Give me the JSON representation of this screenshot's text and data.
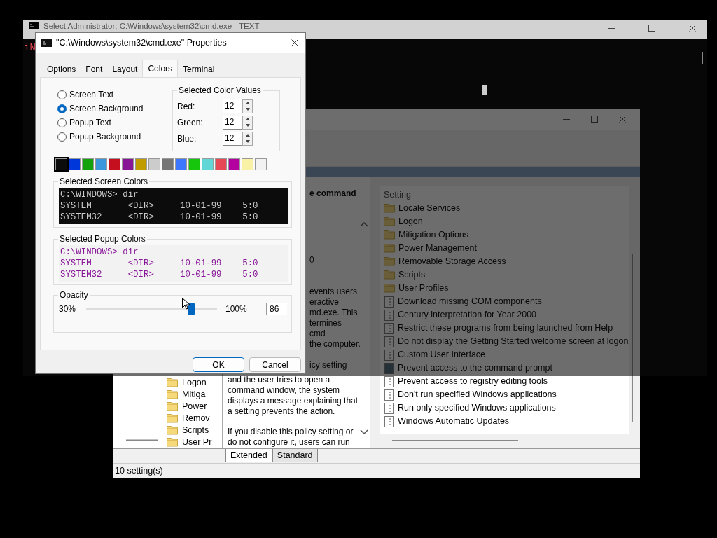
{
  "policy_editor": {
    "tree_items": [
      "Logon",
      "Mitiga",
      "Power",
      "Remov",
      "Scripts",
      "User Pr"
    ],
    "description": [
      {
        "kind": "cut",
        "lines": [
          "e command"
        ]
      },
      {
        "kind": "cut",
        "lines": [
          "0"
        ]
      },
      {
        "kind": "cut",
        "lines": [
          "events users",
          "eractive",
          "md.exe.  This",
          "termines",
          "cmd",
          "the computer."
        ]
      },
      {
        "kind": "mixed",
        "lines": [
          "icy setting",
          "and the user tries to open a",
          "command window, the system",
          "displays a message explaining that",
          "a setting prevents the action."
        ]
      },
      {
        "kind": "full",
        "lines": [
          "If you disable this policy setting or",
          "do not configure it, users can run"
        ]
      }
    ],
    "settings_header": "Setting",
    "settings": [
      {
        "label": "Locale Services",
        "kind": "folder"
      },
      {
        "label": "Logon",
        "kind": "folder"
      },
      {
        "label": "Mitigation Options",
        "kind": "folder"
      },
      {
        "label": "Power Management",
        "kind": "folder"
      },
      {
        "label": "Removable Storage Access",
        "kind": "folder"
      },
      {
        "label": "Scripts",
        "kind": "folder"
      },
      {
        "label": "User Profiles",
        "kind": "folder"
      },
      {
        "label": "Download missing COM components",
        "kind": "policy"
      },
      {
        "label": "Century interpretation for Year 2000",
        "kind": "policy"
      },
      {
        "label": "Restrict these programs from being launched from Help",
        "kind": "policy"
      },
      {
        "label": "Do not display the Getting Started welcome screen at logon",
        "kind": "policy"
      },
      {
        "label": "Custom User Interface",
        "kind": "policy"
      },
      {
        "label": "Prevent access to the command prompt",
        "kind": "highlighted_policy"
      },
      {
        "label": "Prevent access to registry editing tools",
        "kind": "policy"
      },
      {
        "label": "Don't run specified Windows applications",
        "kind": "policy"
      },
      {
        "label": "Run only specified Windows applications",
        "kind": "policy"
      },
      {
        "label": "Windows Automatic Updates",
        "kind": "policy"
      }
    ],
    "view_tabs": [
      {
        "label": "Extended",
        "selected": true
      },
      {
        "label": "Standard",
        "selected": false
      }
    ],
    "status_bar": "10 setting(s)"
  },
  "console_window": {
    "title": "Select Administrator: C:\\Windows\\system32\\cmd.exe - TEXT",
    "output": "iN"
  },
  "dialog": {
    "title": "\"C:\\Windows\\system32\\cmd.exe\" Properties",
    "tabs": [
      {
        "label": "Options",
        "selected": false
      },
      {
        "label": "Font",
        "selected": false
      },
      {
        "label": "Layout",
        "selected": false
      },
      {
        "label": "Colors",
        "selected": true
      },
      {
        "label": "Terminal",
        "selected": false
      }
    ],
    "targets": [
      {
        "label": "Screen Text",
        "selected": false
      },
      {
        "label": "Screen Background",
        "selected": true
      },
      {
        "label": "Popup Text",
        "selected": false
      },
      {
        "label": "Popup Background",
        "selected": false
      }
    ],
    "color_values": {
      "title": "Selected Color Values",
      "fields": [
        {
          "label": "Red:",
          "value": "12"
        },
        {
          "label": "Green:",
          "value": "12"
        },
        {
          "label": "Blue:",
          "value": "12"
        }
      ]
    },
    "palette": [
      {
        "color": "#0c0c0c",
        "selected": true
      },
      {
        "color": "#0037da",
        "selected": false
      },
      {
        "color": "#13a10e",
        "selected": false
      },
      {
        "color": "#3a96dd",
        "selected": false
      },
      {
        "color": "#c50f1f",
        "selected": false
      },
      {
        "color": "#881798",
        "selected": false
      },
      {
        "color": "#c19c00",
        "selected": false
      },
      {
        "color": "#cccccc",
        "selected": false
      },
      {
        "color": "#767676",
        "selected": false
      },
      {
        "color": "#3b78ff",
        "selected": false
      },
      {
        "color": "#16c60c",
        "selected": false
      },
      {
        "color": "#61d6d6",
        "selected": false
      },
      {
        "color": "#e74856",
        "selected": false
      },
      {
        "color": "#b4009e",
        "selected": false
      },
      {
        "color": "#f9f1a5",
        "selected": false
      },
      {
        "color": "#f2f2f2",
        "selected": false
      }
    ],
    "previews": [
      {
        "title": "Selected Screen Colors",
        "kind": "screen",
        "lines": [
          "C:\\WINDOWS> dir",
          "SYSTEM       <DIR>     10-01-99    5:0",
          "SYSTEM32     <DIR>     10-01-99    5:0"
        ]
      },
      {
        "title": "Selected Popup Colors",
        "kind": "popup",
        "lines": [
          "C:\\WINDOWS> dir",
          "SYSTEM       <DIR>     10-01-99    5:0",
          "SYSTEM32     <DIR>     10-01-99    5:0"
        ]
      }
    ],
    "opacity": {
      "title": "Opacity",
      "min_label": "30%",
      "max_label": "100%",
      "level": 0.8,
      "value": "86"
    },
    "buttons": [
      {
        "label": "OK",
        "kind": "primary"
      },
      {
        "label": "Cancel",
        "kind": "secondary"
      }
    ]
  }
}
